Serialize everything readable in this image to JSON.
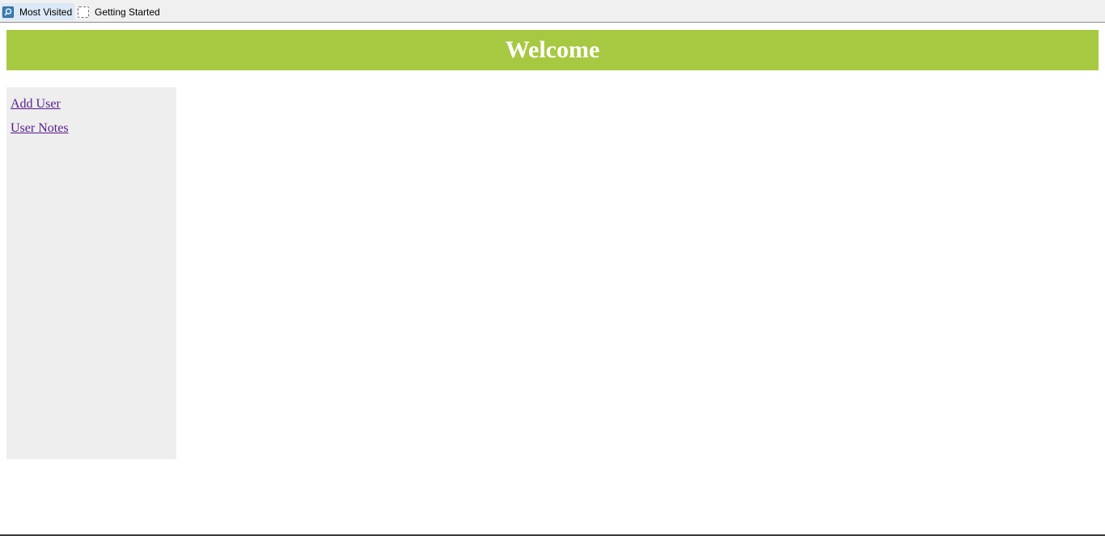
{
  "bookmarks": {
    "items": [
      {
        "label": "Most Visited",
        "icon": "search-icon"
      },
      {
        "label": "Getting Started",
        "icon": "blank-page-icon"
      }
    ]
  },
  "header": {
    "title": "Welcome",
    "background": "#a7c942"
  },
  "sidebar": {
    "links": [
      {
        "label": "Add User"
      },
      {
        "label": "User Notes"
      }
    ]
  }
}
